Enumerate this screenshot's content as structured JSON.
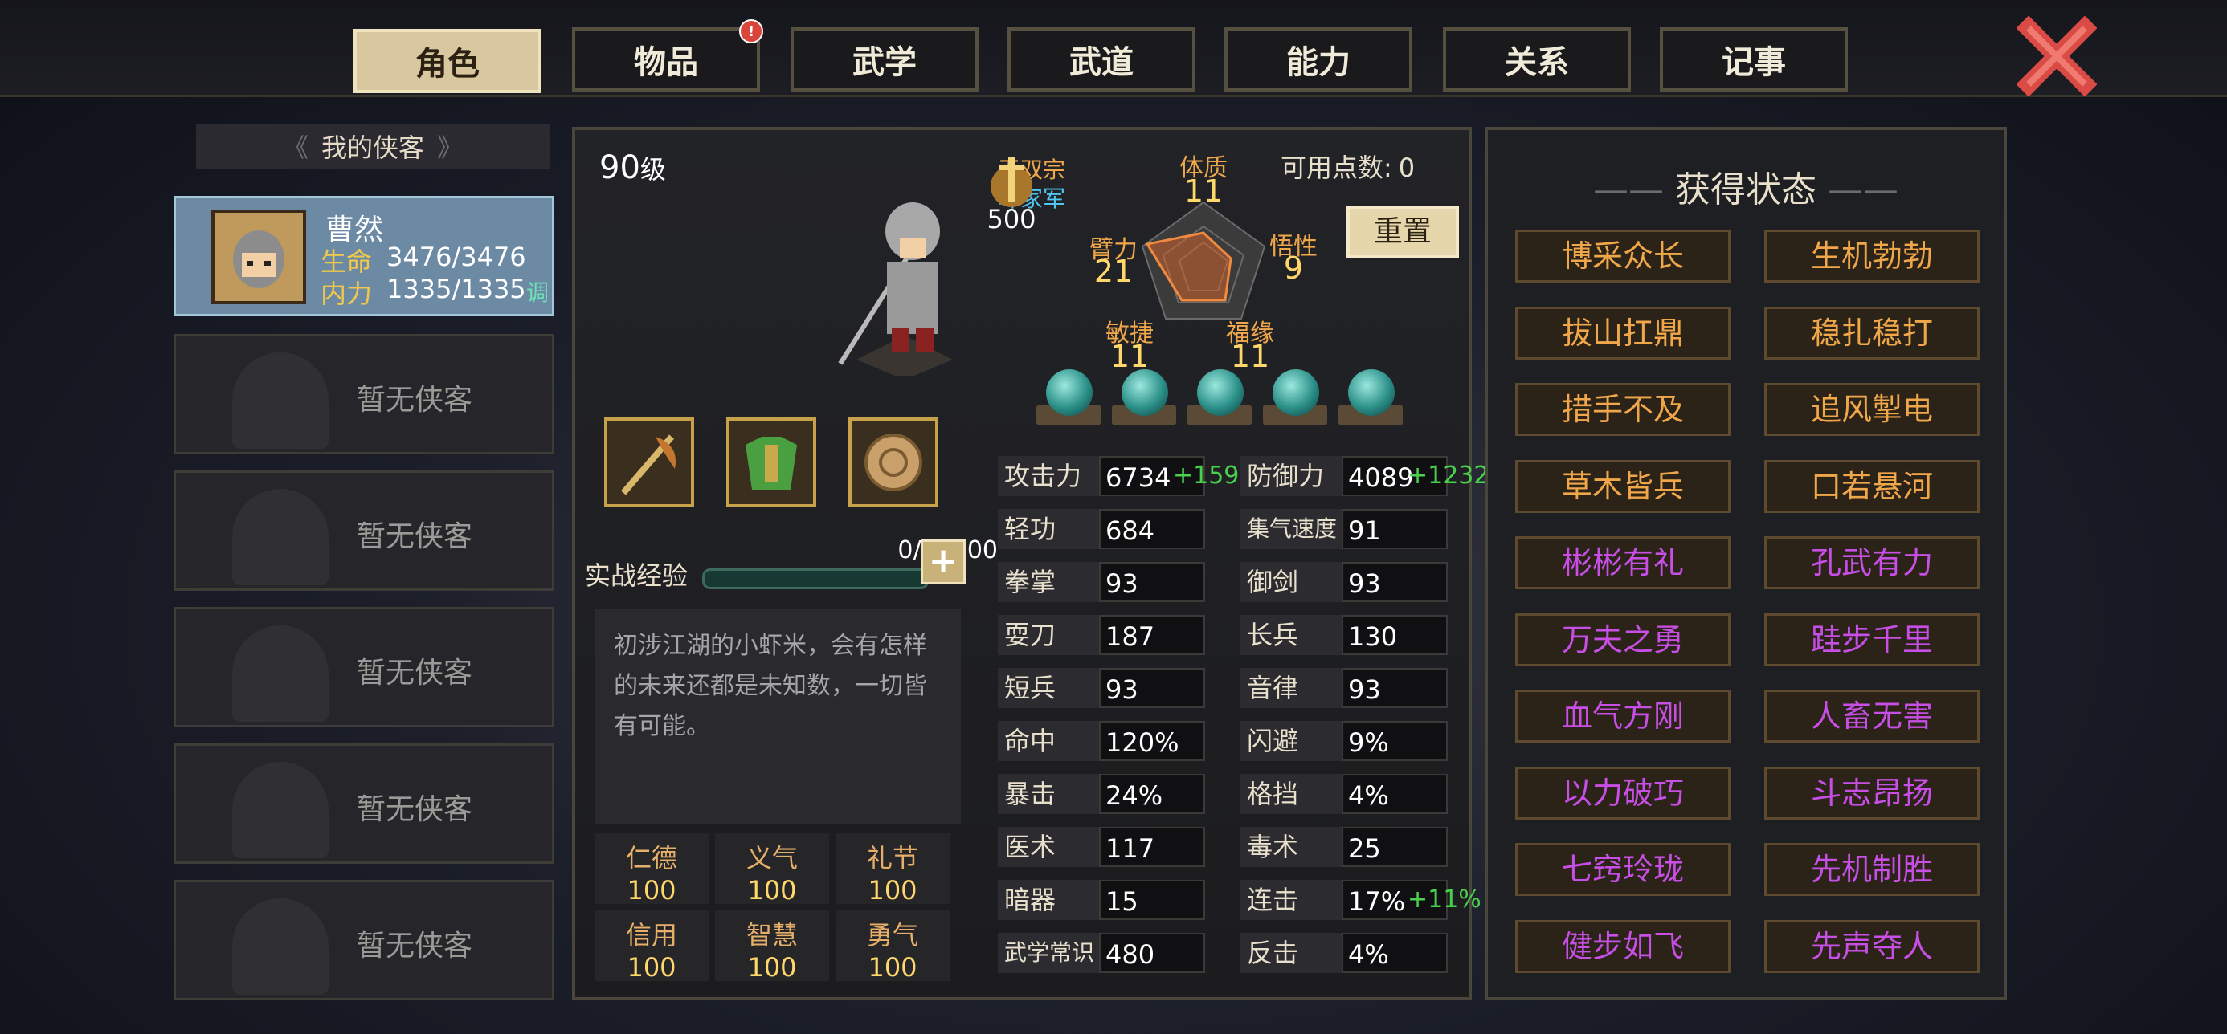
{
  "tabs": [
    {
      "label": "角色"
    },
    {
      "label": "物品"
    },
    {
      "label": "武学"
    },
    {
      "label": "武道"
    },
    {
      "label": "能力"
    },
    {
      "label": "关系"
    },
    {
      "label": "记事"
    }
  ],
  "tab_badge": "!",
  "list": {
    "header": "我的侠客",
    "selected": {
      "name": "曹然",
      "hp_label": "生命",
      "hp": "3476/3476",
      "mp_label": "内力",
      "mp": "1335/1335",
      "adjust": "调"
    },
    "empty_label": "暂无侠客"
  },
  "character": {
    "level": "90",
    "level_unit": "级",
    "sect": "无双宗",
    "faction": "叶家军",
    "power": "500",
    "available_label": "可用点数:",
    "available_points": "0",
    "reset": "重置",
    "attrs": {
      "tizhi": {
        "label": "体质",
        "value": "11"
      },
      "wuxing": {
        "label": "悟性",
        "value": "9"
      },
      "fuyuan": {
        "label": "福缘",
        "value": "11"
      },
      "minjie": {
        "label": "敏捷",
        "value": "11"
      },
      "bili": {
        "label": "臂力",
        "value": "21"
      }
    },
    "exp_label": "实战经验",
    "exp_value": "0/17800",
    "exp_fraction": 0,
    "description": "初涉江湖的小虾米，会有怎样的未来还都是未知数，一切皆有可能。",
    "virtues": [
      {
        "label": "仁德",
        "value": "100"
      },
      {
        "label": "义气",
        "value": "100"
      },
      {
        "label": "礼节",
        "value": "100"
      },
      {
        "label": "信用",
        "value": "100"
      },
      {
        "label": "智慧",
        "value": "100"
      },
      {
        "label": "勇气",
        "value": "100"
      }
    ],
    "stats_left": [
      {
        "label": "攻击力",
        "value": "6734",
        "bonus": "+1591"
      },
      {
        "label": "轻功",
        "value": "684"
      },
      {
        "label": "拳掌",
        "value": "93"
      },
      {
        "label": "耍刀",
        "value": "187"
      },
      {
        "label": "短兵",
        "value": "93"
      },
      {
        "label": "命中",
        "value": "120%"
      },
      {
        "label": "暴击",
        "value": "24%"
      },
      {
        "label": "医术",
        "value": "117"
      },
      {
        "label": "暗器",
        "value": "15"
      },
      {
        "label": "武学常识",
        "value": "480"
      }
    ],
    "stats_right": [
      {
        "label": "防御力",
        "value": "4089",
        "bonus": "+1232"
      },
      {
        "label": "集气速度",
        "value": "91"
      },
      {
        "label": "御剑",
        "value": "93"
      },
      {
        "label": "长兵",
        "value": "130"
      },
      {
        "label": "音律",
        "value": "93"
      },
      {
        "label": "闪避",
        "value": "9%"
      },
      {
        "label": "格挡",
        "value": "4%"
      },
      {
        "label": "毒术",
        "value": "25"
      },
      {
        "label": "连击",
        "value": "17%",
        "bonus": "+11%"
      },
      {
        "label": "反击",
        "value": "4%"
      }
    ]
  },
  "status_panel": {
    "title": "获得状态",
    "chips": [
      {
        "label": "博采众长",
        "color": "orange"
      },
      {
        "label": "生机勃勃",
        "color": "orange"
      },
      {
        "label": "拔山扛鼎",
        "color": "orange"
      },
      {
        "label": "稳扎稳打",
        "color": "orange"
      },
      {
        "label": "措手不及",
        "color": "orange"
      },
      {
        "label": "追风掣电",
        "color": "orange"
      },
      {
        "label": "草木皆兵",
        "color": "orange"
      },
      {
        "label": "口若悬河",
        "color": "orange"
      },
      {
        "label": "彬彬有礼",
        "color": "purple"
      },
      {
        "label": "孔武有力",
        "color": "purple"
      },
      {
        "label": "万夫之勇",
        "color": "purple"
      },
      {
        "label": "跬步千里",
        "color": "purple"
      },
      {
        "label": "血气方刚",
        "color": "purple"
      },
      {
        "label": "人畜无害",
        "color": "purple"
      },
      {
        "label": "以力破巧",
        "color": "purple"
      },
      {
        "label": "斗志昂扬",
        "color": "purple"
      },
      {
        "label": "七窍玲珑",
        "color": "purple"
      },
      {
        "label": "先机制胜",
        "color": "purple"
      },
      {
        "label": "健步如飞",
        "color": "purple"
      },
      {
        "label": "先声夺人",
        "color": "purple"
      }
    ]
  },
  "colors": {
    "orange": "#f0a74a",
    "purple": "#c84fe6",
    "bonus": "#49d04d",
    "gold": "#ffd76a"
  }
}
